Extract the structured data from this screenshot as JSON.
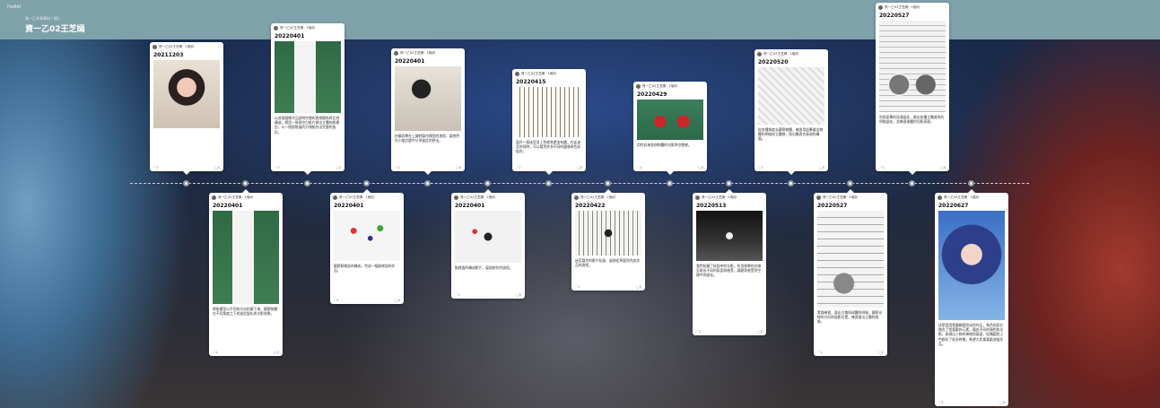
{
  "app": {
    "brand": "Padlet",
    "breadcrumb": "資一乙共享資料 / 個人",
    "board_title": "資一乙02王芝嫣"
  },
  "cards": [
    {
      "author": "資一乙02王芝嫣 · 1個月",
      "date": "20211203",
      "photo": "selfie",
      "text": "",
      "likes": "1",
      "comments": "0"
    },
    {
      "author": "資一乙02王芝嫣 · 1個月",
      "date": "20220401",
      "photo": "model",
      "text": "以這張圖像作品說明空間的透視關係與比例構造，運用一張張空白紙片做出立體的紙模型，以一個個堆疊的方塊組合出完整的造形。",
      "likes": "1",
      "comments": "1"
    },
    {
      "author": "資一乙02王芝嫣 · 1個月",
      "date": "20220401",
      "photo": "class",
      "text": "拍攝同學在上課時製作模型的過程，讓他們在小組討論中分享彼此的想法。",
      "likes": "1",
      "comments": "0"
    },
    {
      "author": "資一乙02王芝嫣 · 1個月",
      "date": "20220415",
      "photo": "maze",
      "text": "製作一個迷宮並上色使其更加有趣，在走迷宮的同時，可以看到許多不同的圖像與色彩組合。",
      "likes": "1",
      "comments": "0"
    },
    {
      "author": "資一乙02王芝嫣 · 1個月",
      "date": "20220429",
      "photo": "apples",
      "text": "用色彩來表現物體的光影與空間感。",
      "likes": "1",
      "comments": "0"
    },
    {
      "author": "資一乙02王芝嫣 · 1個月",
      "date": "20220520",
      "photo": "sketch",
      "text": "從各種角度去觀察物體，練習用鉛筆畫出物體的明暗與立體感，找出最適合表現的構圖。",
      "likes": "1",
      "comments": "0"
    },
    {
      "author": "資一乙02王芝嫣 · 1個月",
      "date": "20220527",
      "photo": "spheres",
      "text": "利用鉛筆的深淺變化，畫出各種立體造形的明暗變化，並練習球體的光影表現。",
      "likes": "1",
      "comments": "0"
    },
    {
      "author": "資一乙02王芝嫣 · 1個月",
      "date": "20220401",
      "photo": "model",
      "text": "將紙模型以不同的方向拍攝下來，觀察物體在不同角度之下的造型變化與光影效果。",
      "likes": "1",
      "comments": "2"
    },
    {
      "author": "資一乙02王芝嫣 · 1個月",
      "date": "20220401",
      "photo": "dots",
      "text": "觀察點線面的構成，完成一幅點線面的作品。",
      "likes": "2",
      "comments": "0"
    },
    {
      "author": "資一乙02王芝嫣 · 1個月",
      "date": "20220401",
      "photo": "video1",
      "text": "點線面的構成影片，展現創作的過程。",
      "likes": "1",
      "comments": "0"
    },
    {
      "author": "資一乙02王芝嫣 · 1個月",
      "date": "20220422",
      "photo": "video2",
      "text": "迷宮製作的影片紀錄，展現從草圖到完成作品的過程。",
      "likes": "1",
      "comments": "0"
    },
    {
      "author": "資一乙02王芝嫣 · 1個月",
      "date": "20220513",
      "photo": "video3",
      "text": "我們拍攝了校園中的光影，利用夜晚的光線呈現出不同的氛圍與感受，讓觀眾感受到空間中的變化。",
      "likes": "1",
      "comments": "0"
    },
    {
      "author": "資一乙02王芝嫣 · 1個月",
      "date": "20220527",
      "photo": "sketch2",
      "text": "素描練習，畫出方塊與球體的明暗，觀察光線的方向與陰影位置，練習畫出立體的效果。",
      "likes": "1",
      "comments": "2"
    },
    {
      "author": "資一乙02王芝嫣 · 1個月",
      "date": "20220627",
      "photo": "anime",
      "text": "這是我用電腦繪圖完成的作品，角色的設計融合了我喜歡的元素，藉由不同的顏色和光影，表現出人物的神情與氛圍，從構圖到上色都花了很多時間，希望大家會喜歡這幅作品。",
      "likes": "2",
      "comments": "0"
    }
  ]
}
